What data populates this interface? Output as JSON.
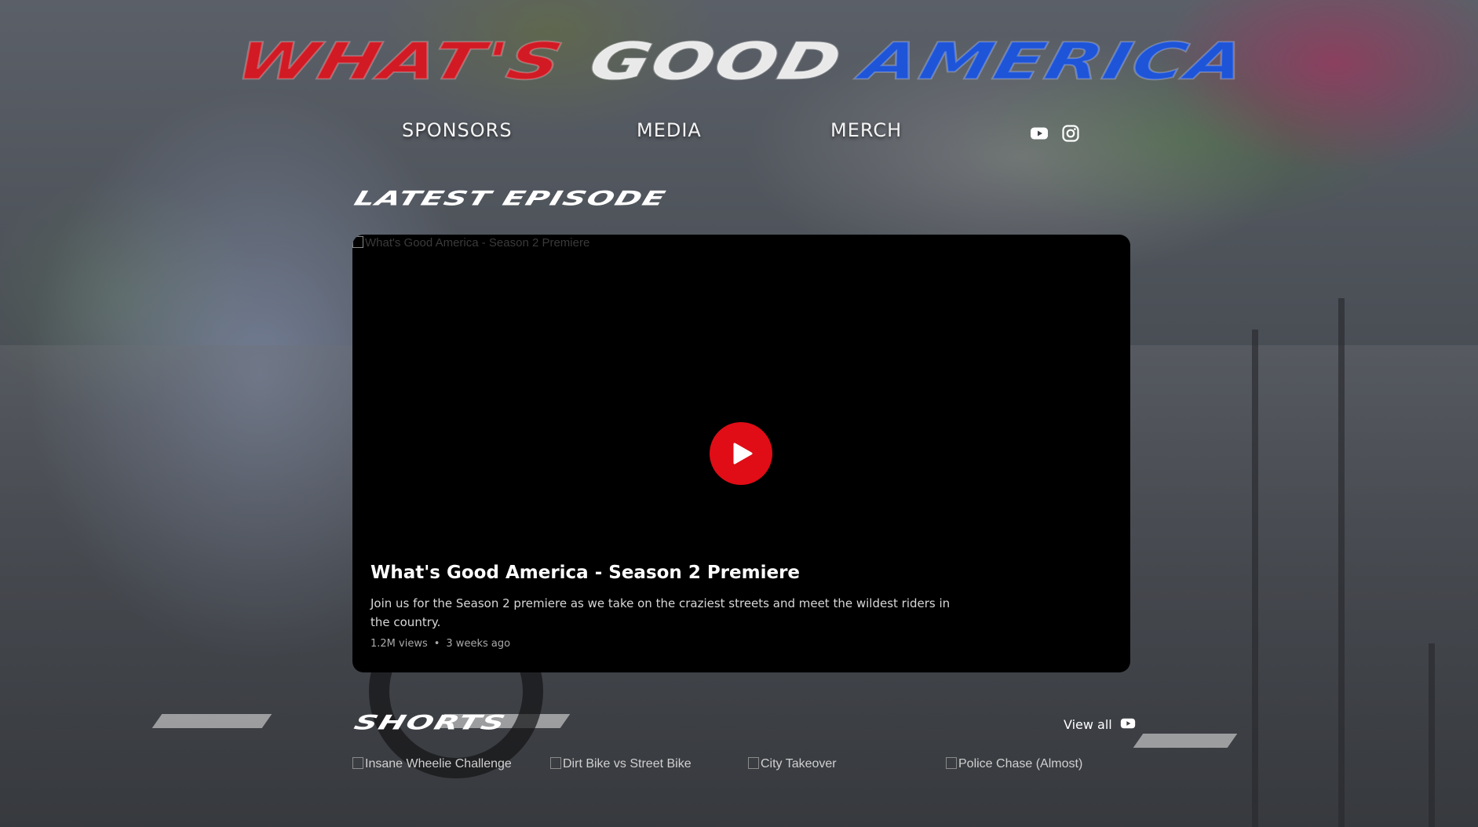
{
  "header": {
    "title_words": [
      "WHAT'S",
      "GOOD",
      "AMERICA"
    ]
  },
  "nav": {
    "sponsors": "SPONSORS",
    "media": "MEDIA",
    "merch": "MERCH"
  },
  "social": {
    "icons": [
      "youtube-icon",
      "instagram-icon"
    ]
  },
  "latest": {
    "section_title": "LATEST EPISODE",
    "thumbnail_alt": "What's Good America - Season 2 Premiere",
    "episode_title": "What's Good America - Season 2 Premiere",
    "description": "Join us for the Season 2 premiere as we take on the craziest streets and meet the wildest riders in the country.",
    "views": "1.2M views",
    "separator": "•",
    "age": "3 weeks ago"
  },
  "shorts": {
    "section_title": "SHORTS",
    "view_all": "View all",
    "items": [
      {
        "alt": "Insane Wheelie Challenge"
      },
      {
        "alt": "Dirt Bike vs Street Bike"
      },
      {
        "alt": "City Takeover"
      },
      {
        "alt": "Police Chase (Almost)"
      }
    ]
  },
  "colors": {
    "red": "#d11a24",
    "white": "#e9e9e9",
    "blue": "#1e54d8",
    "play_button": "#e00d16"
  }
}
